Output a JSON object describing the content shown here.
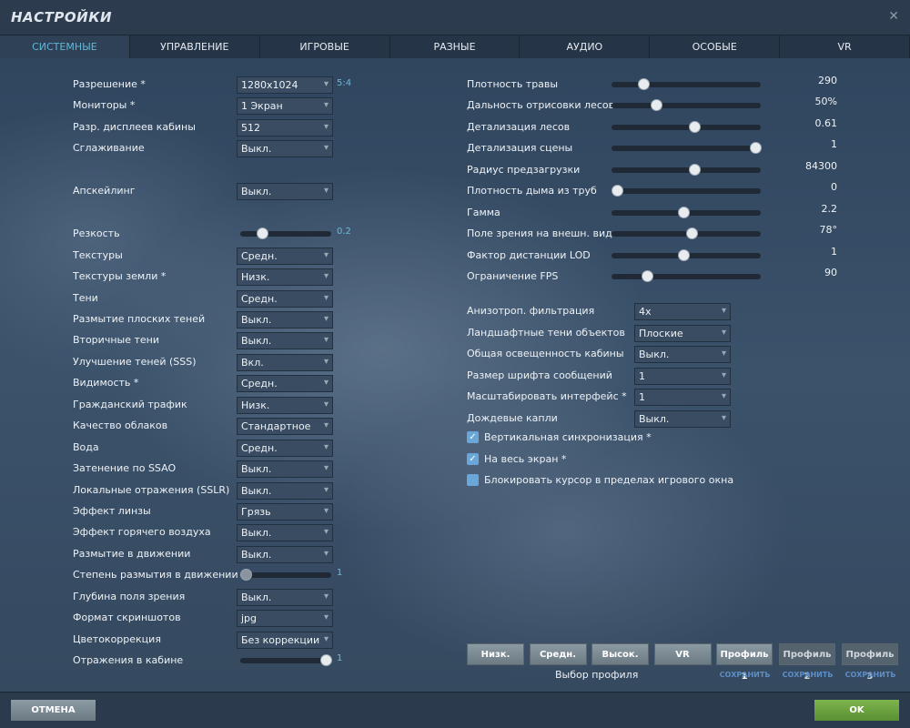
{
  "title": "НАСТРОЙКИ",
  "tabs": [
    "СИСТЕМНЫЕ",
    "УПРАВЛЕНИЕ",
    "ИГРОВЫЕ",
    "РАЗНЫЕ",
    "АУДИО",
    "ОСОБЫЕ",
    "VR"
  ],
  "left": [
    {
      "label": "Разрешение *",
      "type": "select",
      "value": "1280x1024",
      "hint": "5:4",
      "row": 0
    },
    {
      "label": "Мониторы *",
      "type": "select",
      "value": "1 Экран",
      "row": 1
    },
    {
      "label": "Разр. дисплеев кабины",
      "type": "select",
      "value": "512",
      "row": 2
    },
    {
      "label": "Сглаживание",
      "type": "select",
      "value": "Выкл.",
      "row": 3
    },
    {
      "label": "Апскейлинг",
      "type": "select",
      "value": "Выкл.",
      "row": 5
    },
    {
      "label": "Резкость",
      "type": "slider",
      "value": "0.2",
      "fraction": 0.2,
      "row": 7
    },
    {
      "label": "Текстуры",
      "type": "select",
      "value": "Средн.",
      "row": 8
    },
    {
      "label": "Текстуры земли *",
      "type": "select",
      "value": "Низк.",
      "row": 9
    },
    {
      "label": "Тени",
      "type": "select",
      "value": "Средн.",
      "row": 10
    },
    {
      "label": "Размытие плоских теней",
      "type": "select",
      "value": "Выкл.",
      "row": 11
    },
    {
      "label": "Вторичные тени",
      "type": "select",
      "value": "Выкл.",
      "row": 12
    },
    {
      "label": "Улучшение теней (SSS)",
      "type": "select",
      "value": "Вкл.",
      "row": 13
    },
    {
      "label": "Видимость *",
      "type": "select",
      "value": "Средн.",
      "row": 14
    },
    {
      "label": "Гражданский трафик",
      "type": "select",
      "value": "Низк.",
      "row": 15
    },
    {
      "label": "Качество облаков",
      "type": "select",
      "value": "Стандартное",
      "row": 16
    },
    {
      "label": "Вода",
      "type": "select",
      "value": "Средн.",
      "row": 17
    },
    {
      "label": "Затенение по SSAO",
      "type": "select",
      "value": "Выкл.",
      "row": 18
    },
    {
      "label": "Локальные отражения (SSLR)",
      "type": "select",
      "value": "Выкл.",
      "row": 19
    },
    {
      "label": "Эффект линзы",
      "type": "select",
      "value": "Грязь",
      "row": 20
    },
    {
      "label": "Эффект горячего воздуха",
      "type": "select",
      "value": "Выкл.",
      "row": 21
    },
    {
      "label": "Размытие в движении",
      "type": "select",
      "value": "Выкл.",
      "row": 22
    },
    {
      "label": "Степень размытия в движении",
      "type": "slider",
      "value": "1",
      "fraction": 0.0,
      "disabled": true,
      "row": 23
    },
    {
      "label": "Глубина поля зрения",
      "type": "select",
      "value": "Выкл.",
      "row": 24
    },
    {
      "label": "Формат скриншотов",
      "type": "select",
      "value": "jpg",
      "row": 25
    },
    {
      "label": "Цветокоррекция",
      "type": "select",
      "value": "Без коррекции",
      "row": 26
    },
    {
      "label": "Отражения в кабине",
      "type": "slider",
      "value": "1",
      "fraction": 1.0,
      "row": 27
    }
  ],
  "right_sliders": [
    {
      "label": "Плотность травы",
      "value": "290",
      "fraction": 0.19
    },
    {
      "label": "Дальность отрисовки лесов",
      "value": "50%",
      "fraction": 0.28
    },
    {
      "label": "Детализация лесов",
      "value": "0.61",
      "fraction": 0.56
    },
    {
      "label": "Детализация сцены",
      "value": "1",
      "fraction": 1.0
    },
    {
      "label": "Радиус предзагрузки",
      "value": "84300",
      "fraction": 0.56
    },
    {
      "label": "Плотность дыма из труб",
      "value": "0",
      "fraction": 0.0
    },
    {
      "label": "Гамма",
      "value": "2.2",
      "fraction": 0.48
    },
    {
      "label": "Поле зрения на внешн. видах",
      "value": "78°",
      "fraction": 0.54
    },
    {
      "label": "Фактор дистанции LOD",
      "value": "1",
      "fraction": 0.48
    },
    {
      "label": "Ограничение FPS",
      "value": "90",
      "fraction": 0.22
    }
  ],
  "right_selects": [
    {
      "label": "Анизотроп. фильтрация",
      "value": "4x"
    },
    {
      "label": "Ландшафтные тени объектов",
      "value": "Плоские"
    },
    {
      "label": "Общая освещенность кабины",
      "value": "Выкл."
    },
    {
      "label": "Размер шрифта сообщений",
      "value": "1"
    },
    {
      "label": "Масштабировать интерфейс *",
      "value": "1"
    },
    {
      "label": "Дождевые капли",
      "value": "Выкл."
    }
  ],
  "checkboxes": [
    {
      "label": "Вертикальная синхронизация *",
      "checked": true
    },
    {
      "label": "На весь экран *",
      "checked": true
    },
    {
      "label": "Блокировать курсор в пределах игрового окна",
      "checked": false
    }
  ],
  "presets": [
    "Низк.",
    "Средн.",
    "Высок.",
    "VR"
  ],
  "profiles": [
    "Профиль 1",
    "Профиль 2",
    "Профиль 3"
  ],
  "save_label": "СОХРАНИТЬ",
  "profile_caption": "Выбор профиля",
  "cancel": "ОТМЕНА",
  "ok": "OK"
}
